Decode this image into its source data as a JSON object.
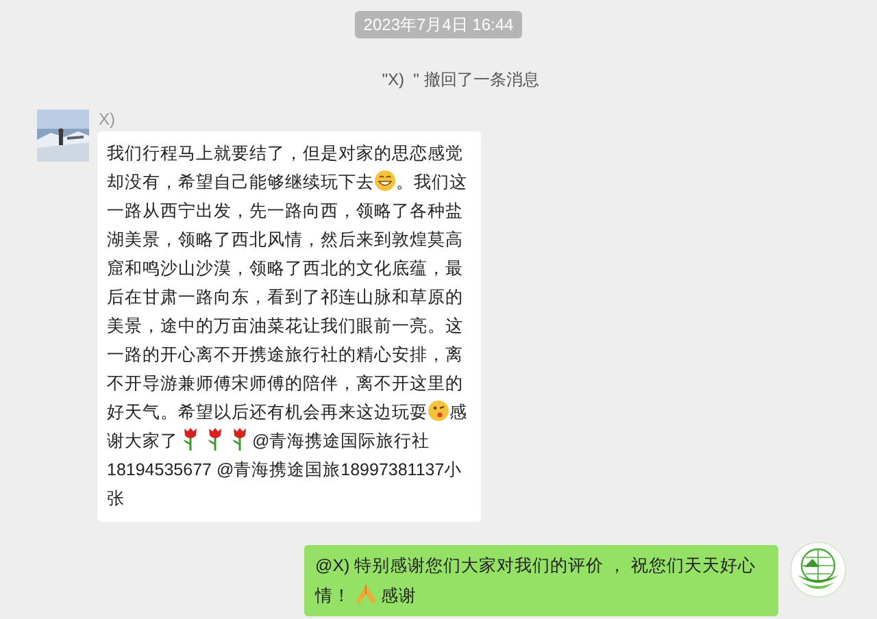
{
  "timestamp": "2023年7月4日 16:44",
  "recall_notice": "\"X)  \" 撤回了一条消息",
  "messages": [
    {
      "kind": "incoming",
      "sender": "X)",
      "parts": [
        {
          "kind": "text",
          "text": "我们行程马上就要结了，但是对家的思恋感觉却没有，希望自己能够继续玩下去"
        },
        {
          "kind": "grin"
        },
        {
          "kind": "text",
          "text": "。我们这一路从西宁出发，先一路向西，领略了各种盐湖美景，领略了西北风情，然后来到敦煌莫高窟和鸣沙山沙漠，领略了西北的文化底蕴，最后在甘肃一路向东，看到了祁连山脉和草原的美景，途中的万亩油菜花让我们眼前一亮。这一路的开心离不开携途旅行社的精心安排，离不开导游兼师傅宋师傅的陪伴，离不开这里的好天气。希望以后还有机会再来这边玩耍"
        },
        {
          "kind": "wink"
        },
        {
          "kind": "text",
          "text": "感谢大家了"
        },
        {
          "kind": "rose"
        },
        {
          "kind": "rose"
        },
        {
          "kind": "rose"
        },
        {
          "kind": "text",
          "text": "@青海携途国际旅行社18194535677 @青海携途国旅18997381137小张"
        }
      ]
    },
    {
      "kind": "outgoing",
      "avatar": {
        "kind": "logo"
      },
      "parts": [
        {
          "kind": "text",
          "text": "@X)  特别感谢您们大家对我们的评价 ， 祝您们天天好心情！"
        },
        {
          "kind": "pray"
        },
        {
          "kind": "text",
          "text": "感谢"
        }
      ]
    }
  ]
}
